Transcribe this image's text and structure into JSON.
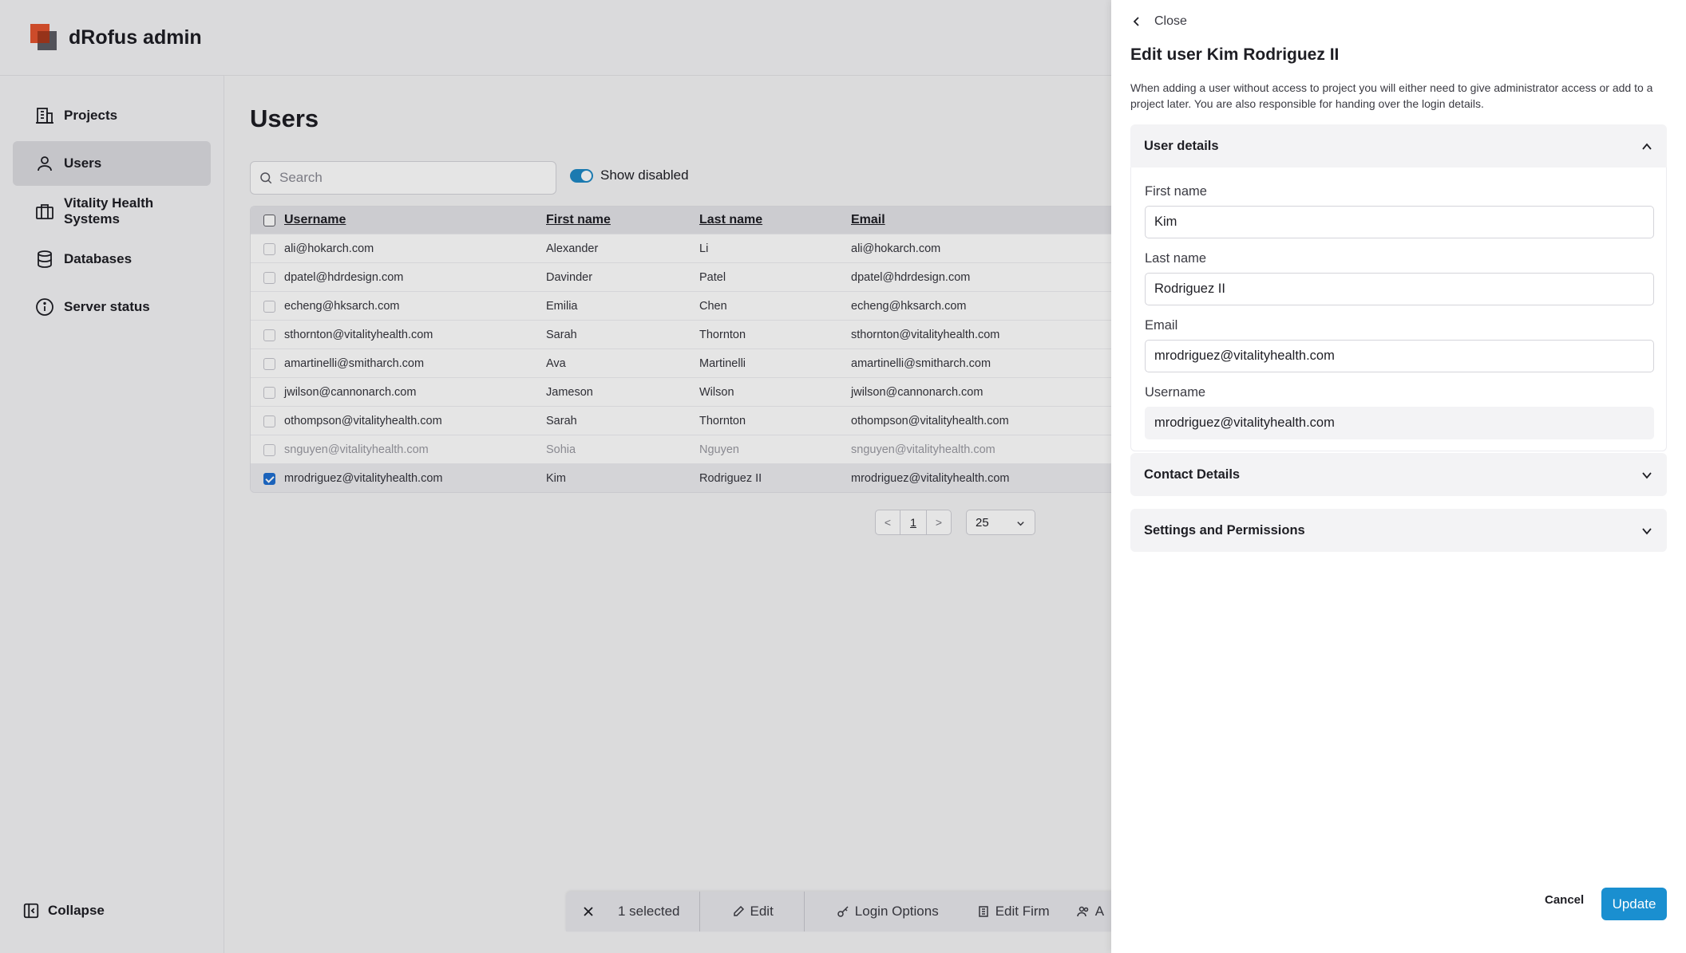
{
  "app": {
    "title": "dRofus admin"
  },
  "sidebar": {
    "items": [
      {
        "label": "Projects",
        "icon": "building-icon"
      },
      {
        "label": "Users",
        "icon": "user-icon",
        "active": true
      },
      {
        "label": "Vitality Health Systems",
        "icon": "briefcase-icon"
      },
      {
        "label": "Databases",
        "icon": "database-icon"
      },
      {
        "label": "Server status",
        "icon": "info-icon"
      }
    ],
    "collapse_label": "Collapse"
  },
  "users_page": {
    "title": "Users",
    "search_placeholder": "Search",
    "show_disabled_label": "Show disabled",
    "show_disabled": true,
    "columns": [
      "Username",
      "First name",
      "Last name",
      "Email"
    ],
    "rows": [
      {
        "username": "ali@hokarch.com",
        "first": "Alexander",
        "last": "Li",
        "email": "ali@hokarch.com"
      },
      {
        "username": "dpatel@hdrdesign.com",
        "first": "Davinder",
        "last": "Patel",
        "email": "dpatel@hdrdesign.com"
      },
      {
        "username": "echeng@hksarch.com",
        "first": "Emilia",
        "last": "Chen",
        "email": "echeng@hksarch.com"
      },
      {
        "username": "sthornton@vitalityhealth.com",
        "first": "Sarah",
        "last": "Thornton",
        "email": "sthornton@vitalityhealth.com"
      },
      {
        "username": "amartinelli@smitharch.com",
        "first": "Ava",
        "last": "Martinelli",
        "email": "amartinelli@smitharch.com"
      },
      {
        "username": "jwilson@cannonarch.com",
        "first": "Jameson",
        "last": "Wilson",
        "email": "jwilson@cannonarch.com"
      },
      {
        "username": "othompson@vitalityhealth.com",
        "first": "Sarah",
        "last": "Thornton",
        "email": "othompson@vitalityhealth.com"
      },
      {
        "username": "snguyen@vitalityhealth.com",
        "first": "Sohia",
        "last": "Nguyen",
        "email": "snguyen@vitalityhealth.com"
      },
      {
        "username": "mrodriguez@vitalityhealth.com",
        "first": "Kim",
        "last": "Rodriguez II",
        "email": "mrodriguez@vitalityhealth.com"
      }
    ],
    "pager": {
      "prev": "<",
      "page": "1",
      "next": ">",
      "per_page": "25"
    }
  },
  "action_bar": {
    "selected_label": "1 selected",
    "edit_label": "Edit",
    "login_options_label": "Login Options",
    "edit_firm_label": "Edit Firm",
    "truncated_label": "A"
  },
  "drawer": {
    "close_label": "Close",
    "title": "Edit user Kim Rodriguez II",
    "description": "When adding a user without access to project you will either need to give administrator access or add to a project later. You are also responsible for handing over the login details.",
    "user_details": {
      "heading": "User details",
      "first_name_label": "First name",
      "first_name": "Kim",
      "last_name_label": "Last name",
      "last_name": "Rodriguez II",
      "email_label": "Email",
      "email": "mrodriguez@vitalityhealth.com",
      "username_label": "Username",
      "username": "mrodriguez@vitalityhealth.com"
    },
    "contact_details_heading": "Contact Details",
    "settings_heading": "Settings and Permissions",
    "cancel_label": "Cancel",
    "update_label": "Update"
  },
  "colors": {
    "accent": "#1a8fd0",
    "checkbox": "#1f6fd1",
    "brand_red": "#e4542f"
  }
}
